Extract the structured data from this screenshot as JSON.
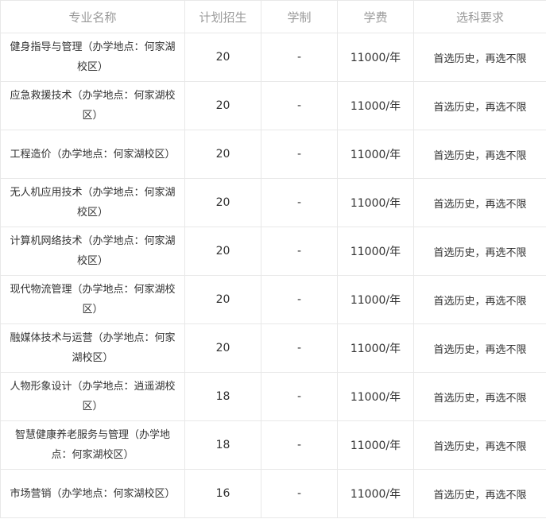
{
  "table": {
    "headers": [
      "专业名称",
      "计划招生",
      "学制",
      "学费",
      "选科要求"
    ],
    "rows": [
      {
        "name": "健身指导与管理（办学地点：何家湖校区）",
        "plan": "20",
        "duration": "-",
        "tuition": "11000/年",
        "requirement": "首选历史，再选不限"
      },
      {
        "name": "应急救援技术（办学地点：何家湖校区）",
        "plan": "20",
        "duration": "-",
        "tuition": "11000/年",
        "requirement": "首选历史，再选不限"
      },
      {
        "name": "工程造价（办学地点：何家湖校区）",
        "plan": "20",
        "duration": "-",
        "tuition": "11000/年",
        "requirement": "首选历史，再选不限"
      },
      {
        "name": "无人机应用技术（办学地点：何家湖校区）",
        "plan": "20",
        "duration": "-",
        "tuition": "11000/年",
        "requirement": "首选历史，再选不限"
      },
      {
        "name": "计算机网络技术（办学地点：何家湖校区）",
        "plan": "20",
        "duration": "-",
        "tuition": "11000/年",
        "requirement": "首选历史，再选不限"
      },
      {
        "name": "现代物流管理（办学地点：何家湖校区）",
        "plan": "20",
        "duration": "-",
        "tuition": "11000/年",
        "requirement": "首选历史，再选不限"
      },
      {
        "name": "融媒体技术与运营（办学地点：何家湖校区）",
        "plan": "20",
        "duration": "-",
        "tuition": "11000/年",
        "requirement": "首选历史，再选不限"
      },
      {
        "name": "人物形象设计（办学地点：逍遥湖校区）",
        "plan": "18",
        "duration": "-",
        "tuition": "11000/年",
        "requirement": "首选历史，再选不限"
      },
      {
        "name": "智慧健康养老服务与管理（办学地点：何家湖校区）",
        "plan": "18",
        "duration": "-",
        "tuition": "11000/年",
        "requirement": "首选历史，再选不限"
      },
      {
        "name": "市场营销（办学地点：何家湖校区）",
        "plan": "16",
        "duration": "-",
        "tuition": "11000/年",
        "requirement": "首选历史，再选不限"
      }
    ]
  }
}
